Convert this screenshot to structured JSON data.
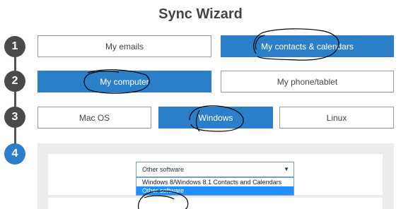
{
  "title": "Sync Wizard",
  "steps": [
    "1",
    "2",
    "3",
    "4"
  ],
  "row1": {
    "my_emails": "My emails",
    "contacts_calendars": "My contacts & calendars"
  },
  "row2": {
    "my_computer": "My computer",
    "phone_tablet": "My phone/tablet"
  },
  "row3": {
    "mac": "Mac OS",
    "windows": "Windows",
    "linux": "Linux"
  },
  "software_select": {
    "value": "Other software",
    "options": [
      "Windows 8/Windows 8.1 Contacts and Calendars",
      "Other software"
    ],
    "highlighted": "Other software"
  },
  "colors": {
    "accent": "#2b7fc8",
    "step": "#4a4a4a",
    "panel": "#ececec"
  }
}
